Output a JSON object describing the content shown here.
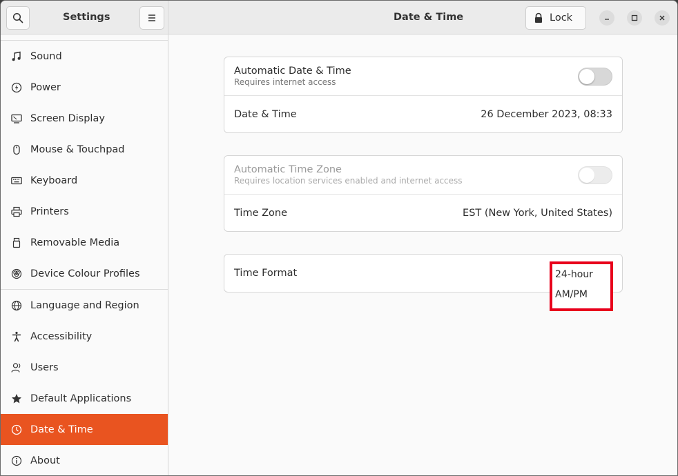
{
  "sidebar": {
    "title": "Settings",
    "items": [
      {
        "label": "Sound",
        "icon": "music-note-icon"
      },
      {
        "label": "Power",
        "icon": "power-icon"
      },
      {
        "label": "Screen Display",
        "icon": "display-icon"
      },
      {
        "label": "Mouse & Touchpad",
        "icon": "mouse-icon"
      },
      {
        "label": "Keyboard",
        "icon": "keyboard-icon"
      },
      {
        "label": "Printers",
        "icon": "printer-icon"
      },
      {
        "label": "Removable Media",
        "icon": "removable-media-icon"
      },
      {
        "label": "Device Colour Profiles",
        "icon": "color-profile-icon"
      },
      {
        "label": "Language and Region",
        "icon": "globe-icon"
      },
      {
        "label": "Accessibility",
        "icon": "accessibility-icon"
      },
      {
        "label": "Users",
        "icon": "users-icon"
      },
      {
        "label": "Default Applications",
        "icon": "star-icon"
      },
      {
        "label": "Date & Time",
        "icon": "clock-icon",
        "active": true
      },
      {
        "label": "About",
        "icon": "info-icon"
      }
    ]
  },
  "header": {
    "title": "Date & Time",
    "lock_label": "Lock"
  },
  "cards": {
    "auto_datetime_title": "Automatic Date & Time",
    "auto_datetime_sub": "Requires internet access",
    "datetime_label": "Date & Time",
    "datetime_value": "26 December 2023, 08:33",
    "auto_timezone_title": "Automatic Time Zone",
    "auto_timezone_sub": "Requires location services enabled and internet access",
    "timezone_label": "Time Zone",
    "timezone_value": "EST (New York, United States)",
    "time_format_label": "Time Format"
  },
  "time_format_popup": {
    "options": [
      "24-hour",
      "AM/PM"
    ]
  },
  "colors": {
    "accent": "#e95420",
    "highlight_box": "#e8001c"
  }
}
